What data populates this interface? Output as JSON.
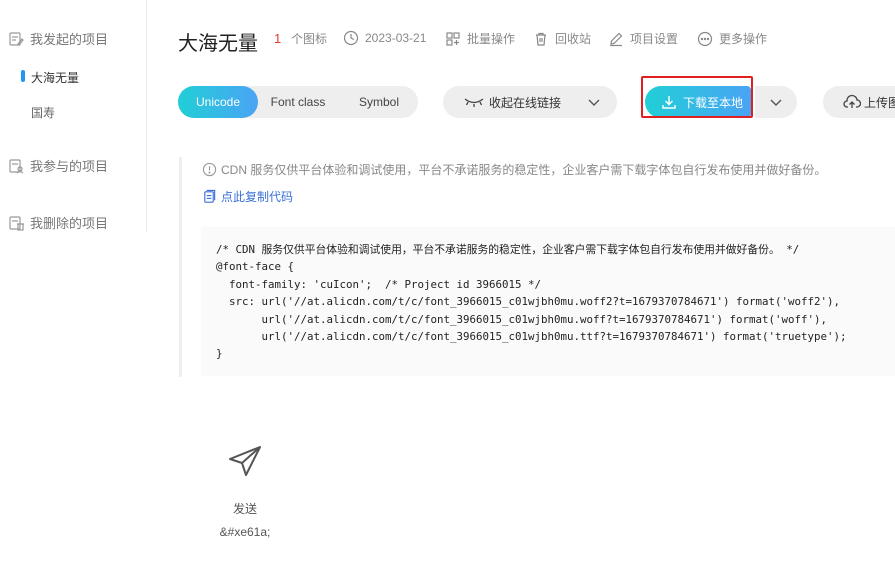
{
  "sidebar": {
    "sections": [
      {
        "label": "我发起的项目",
        "icon": "edit-doc-icon"
      },
      {
        "label": "我参与的项目",
        "icon": "user-doc-icon"
      },
      {
        "label": "我删除的项目",
        "icon": "trash-doc-icon"
      }
    ],
    "items": [
      {
        "label": "大海无量",
        "active": true
      },
      {
        "label": "国寿",
        "active": false
      }
    ]
  },
  "header": {
    "title": "大海无量",
    "icon_count": "1",
    "icon_count_label": "个图标",
    "date": "2023-03-21",
    "batch": "批量操作",
    "recycle": "回收站",
    "settings": "项目设置",
    "more": "更多操作"
  },
  "toolbar": {
    "tabs": [
      "Unicode",
      "Font class",
      "Symbol"
    ],
    "active_tab": "Unicode",
    "collapse_link": "收起在线链接",
    "download": "下载至本地",
    "upload": "上传图"
  },
  "notice": {
    "text": "CDN 服务仅供平台体验和调试使用，平台不承诺服务的稳定性，企业客户需下载字体包自行发布使用并做好备份。",
    "copy_label": "点此复制代码"
  },
  "code": {
    "lines": [
      "/* CDN 服务仅供平台体验和调试使用，平台不承诺服务的稳定性，企业客户需下载字体包自行发布使用并做好备份。 */",
      "@font-face {",
      "  font-family: 'cuIcon';  /* Project id 3966015 */",
      "  src: url('//at.alicdn.com/t/c/font_3966015_c01wjbh0mu.woff2?t=1679370784671') format('woff2'),",
      "       url('//at.alicdn.com/t/c/font_3966015_c01wjbh0mu.woff?t=1679370784671') format('woff'),",
      "       url('//at.alicdn.com/t/c/font_3966015_c01wjbh0mu.ttf?t=1679370784671') format('truetype');",
      "}"
    ]
  },
  "icons": [
    {
      "name": "发送",
      "code": "&#xe61a;",
      "glyph": "send-icon"
    }
  ],
  "colors": {
    "accent_start": "#21cfd6",
    "accent_end": "#4aa3f5",
    "highlight_border": "#e02020",
    "count_red": "#e53935",
    "link_blue": "#3a6fd8"
  }
}
